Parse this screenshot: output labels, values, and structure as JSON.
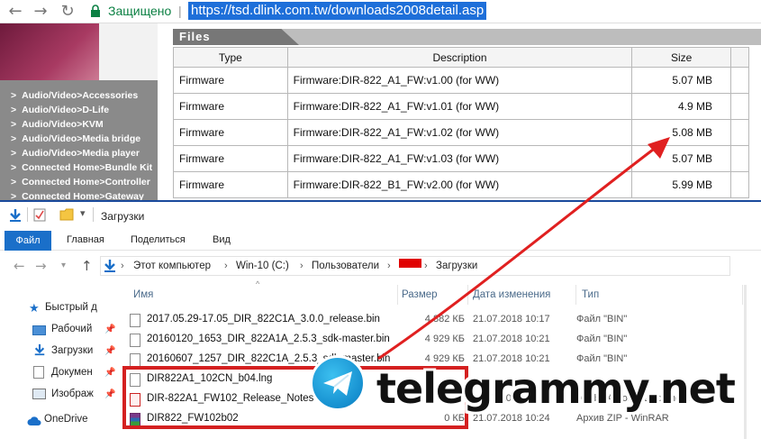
{
  "browser": {
    "secure_label": "Защищено",
    "separator": "|",
    "url": "https://tsd.dlink.com.tw/downloads2008detail.asp",
    "back_icon": "arrow-left-icon",
    "forward_icon": "arrow-right-icon",
    "reload_icon": "reload-icon"
  },
  "sidebar": {
    "items": [
      "Audio/Video>Accessories",
      "Audio/Video>D-Life",
      "Audio/Video>KVM",
      "Audio/Video>Media bridge",
      "Audio/Video>Media player",
      "Connected Home>Bundle Kit",
      "Connected Home>Controller",
      "Connected Home>Gateway"
    ]
  },
  "files_section": {
    "title": "Files",
    "columns": [
      "Type",
      "Description",
      "Size"
    ],
    "rows": [
      {
        "type": "Firmware",
        "description": "Firmware:DIR-822_A1_FW:v1.00 (for WW)",
        "size": "5.07 MB"
      },
      {
        "type": "Firmware",
        "description": "Firmware:DIR-822_A1_FW:v1.01 (for WW)",
        "size": "4.9 MB"
      },
      {
        "type": "Firmware",
        "description": "Firmware:DIR-822_A1_FW:v1.02 (for WW)",
        "size": "5.08 MB"
      },
      {
        "type": "Firmware",
        "description": "Firmware:DIR-822_A1_FW:v1.03 (for WW)",
        "size": "5.07 MB"
      },
      {
        "type": "Firmware",
        "description": "Firmware:DIR-822_B1_FW:v2.00 (for WW)",
        "size": "5.99 MB"
      }
    ]
  },
  "explorer": {
    "window_title": "Загрузки",
    "ribbon_tabs": [
      "Файл",
      "Главная",
      "Поделиться",
      "Вид"
    ],
    "breadcrumb": [
      "Этот компьютер",
      "Win-10 (C:)",
      "Пользователи",
      "Загрузки"
    ],
    "nav_items": [
      "Быстрый д",
      "Рабочий",
      "Загрузки",
      "Докумен",
      "Изображ",
      "OneDrive"
    ],
    "columns": {
      "name": "Имя",
      "size": "Размер",
      "modified": "Дата изменения",
      "type": "Тип"
    },
    "files": [
      {
        "name": "2017.05.29-17.05_DIR_822C1A_3.0.0_release.bin",
        "size": "4 882 КБ",
        "date": "21.07.2018 10:17",
        "type": "Файл \"BIN\""
      },
      {
        "name": "20160120_1653_DIR_822A1A_2.5.3_sdk-master.bin",
        "size": "4 929 КБ",
        "date": "21.07.2018 10:21",
        "type": "Файл \"BIN\""
      },
      {
        "name": "20160607_1257_DIR_822C1A_2.5.3_sdk-master.bin",
        "size": "4 929 КБ",
        "date": "21.07.2018 10:21",
        "type": "Файл \"BIN\""
      },
      {
        "name": "DIR822A1_102CN_b04.lng",
        "size": "",
        "date": "",
        "type": ""
      },
      {
        "name": "DIR-822A1_FW102_Release_Notes",
        "size": "0 КБ",
        "date": "21.07.2018 10:2",
        "type": "Adobe Acrobat Document"
      },
      {
        "name": "DIR822_FW102b02",
        "size": "0 КБ",
        "date": "21.07.2018 10:24",
        "type": "Архив ZIP - WinRAR"
      }
    ]
  },
  "watermark": {
    "text": "telegrammy.net"
  },
  "colors": {
    "accent": "#1a6fc9",
    "highlight_red": "#d42020",
    "url_highlight": "#1e6fd9"
  }
}
